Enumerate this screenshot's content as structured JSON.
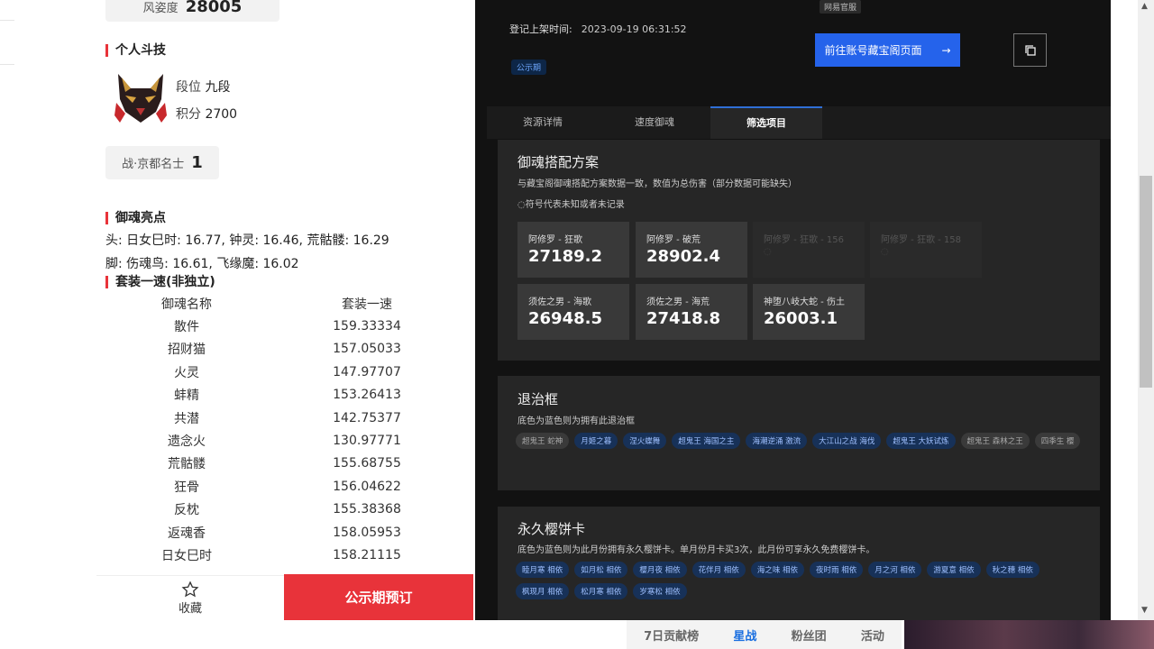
{
  "left": {
    "elegance": {
      "label": "风姿度",
      "value": "28005"
    },
    "arena_title": "个人斗技",
    "rank": {
      "label": "段位",
      "value": "九段"
    },
    "points": {
      "label": "积分",
      "value": "2700"
    },
    "war": {
      "label": "战·京都名士",
      "value": "1"
    },
    "highlights_title": "御魂亮点",
    "highlights": [
      "头: 日女巳时: 16.77, 钟灵: 16.46, 荒骷髅: 16.29",
      "脚: 伤魂鸟: 16.61, 飞缘魔: 16.02"
    ],
    "set_speed_title": "套装一速(非独立)",
    "table": {
      "headers": [
        "御魂名称",
        "套装一速"
      ],
      "rows": [
        [
          "散件",
          "159.33334"
        ],
        [
          "招财猫",
          "157.05033"
        ],
        [
          "火灵",
          "147.97707"
        ],
        [
          "蚌精",
          "153.26413"
        ],
        [
          "共潜",
          "142.75377"
        ],
        [
          "遗念火",
          "130.97771"
        ],
        [
          "荒骷髅",
          "155.68755"
        ],
        [
          "狂骨",
          "156.04622"
        ],
        [
          "反枕",
          "155.38368"
        ],
        [
          "返魂香",
          "158.05953"
        ],
        [
          "日女巳时",
          "158.21115"
        ],
        [
          "",
          ""
        ]
      ]
    },
    "favorite_label": "收藏",
    "presale_label": "公示期预订"
  },
  "right": {
    "listed_label": "登记上架时间:",
    "listed_time": "2023-09-19 06:31:52",
    "status_badge": "公示期",
    "official_badge": "网易官服",
    "goto_button": "前往账号藏宝阁页面",
    "tabs": [
      "资源详情",
      "速度御魂",
      "筛选项目"
    ],
    "active_tab": 2,
    "soul_panel": {
      "title": "御魂搭配方案",
      "subtitle": "与藏宝阁御魂搭配方案数据一致，数值为总伤害（部分数据可能缺失）",
      "note": "◌符号代表未知或者未记录",
      "tiles": [
        {
          "name": "阿修罗 - 狂歌",
          "value": "27189.2",
          "dim": false
        },
        {
          "name": "阿修罗 - 破荒",
          "value": "28902.4",
          "dim": false
        },
        {
          "name": "阿修罗 - 狂歌 - 156",
          "value": "◌",
          "dim": true
        },
        {
          "name": "阿修罗 - 狂歌 - 158",
          "value": "◌",
          "dim": true
        },
        {
          "name": "须佐之男 - 海歌",
          "value": "26948.5",
          "dim": false
        },
        {
          "name": "须佐之男 - 海荒",
          "value": "27418.8",
          "dim": false
        },
        {
          "name": "神堕八岐大蛇 - 伤土",
          "value": "26003.1",
          "dim": false
        }
      ]
    },
    "retreat_panel": {
      "title": "退治框",
      "subtitle": "底色为蓝色则为拥有此退治框",
      "tags": [
        {
          "text": "超鬼王 蛇神",
          "owned": false
        },
        {
          "text": "月姬之暮",
          "owned": true
        },
        {
          "text": "涅火蝶舞",
          "owned": true
        },
        {
          "text": "超鬼王 海国之主",
          "owned": true
        },
        {
          "text": "海潮逆涌 激流",
          "owned": true
        },
        {
          "text": "大江山之战 海伐",
          "owned": true
        },
        {
          "text": "超鬼王 大妖试炼",
          "owned": true
        },
        {
          "text": "超鬼王 森林之王",
          "owned": false
        },
        {
          "text": "四季生 樱",
          "owned": false
        }
      ]
    },
    "sakura_panel": {
      "title": "永久樱饼卡",
      "subtitle": "底色为蓝色则为此月份拥有永久樱饼卡。单月份月卡买3次，此月份可享永久免费樱饼卡。",
      "tags": [
        {
          "text": "睦月寒 相依",
          "owned": true
        },
        {
          "text": "如月松 相依",
          "owned": true
        },
        {
          "text": "樱月夜 相依",
          "owned": true
        },
        {
          "text": "花伴月 相依",
          "owned": true
        },
        {
          "text": "海之味 相依",
          "owned": true
        },
        {
          "text": "夜时雨 相依",
          "owned": true
        },
        {
          "text": "月之河 相依",
          "owned": true
        },
        {
          "text": "游夏意 相依",
          "owned": true
        },
        {
          "text": "秋之穗 相依",
          "owned": true
        },
        {
          "text": "枫现月 相依",
          "owned": true
        },
        {
          "text": "松月寒 相依",
          "owned": true
        },
        {
          "text": "岁寒松 相依",
          "owned": true
        }
      ]
    }
  },
  "bottom_nav": {
    "items": [
      "7日贡献榜",
      "星战",
      "粉丝团",
      "活动"
    ],
    "active": 1
  }
}
